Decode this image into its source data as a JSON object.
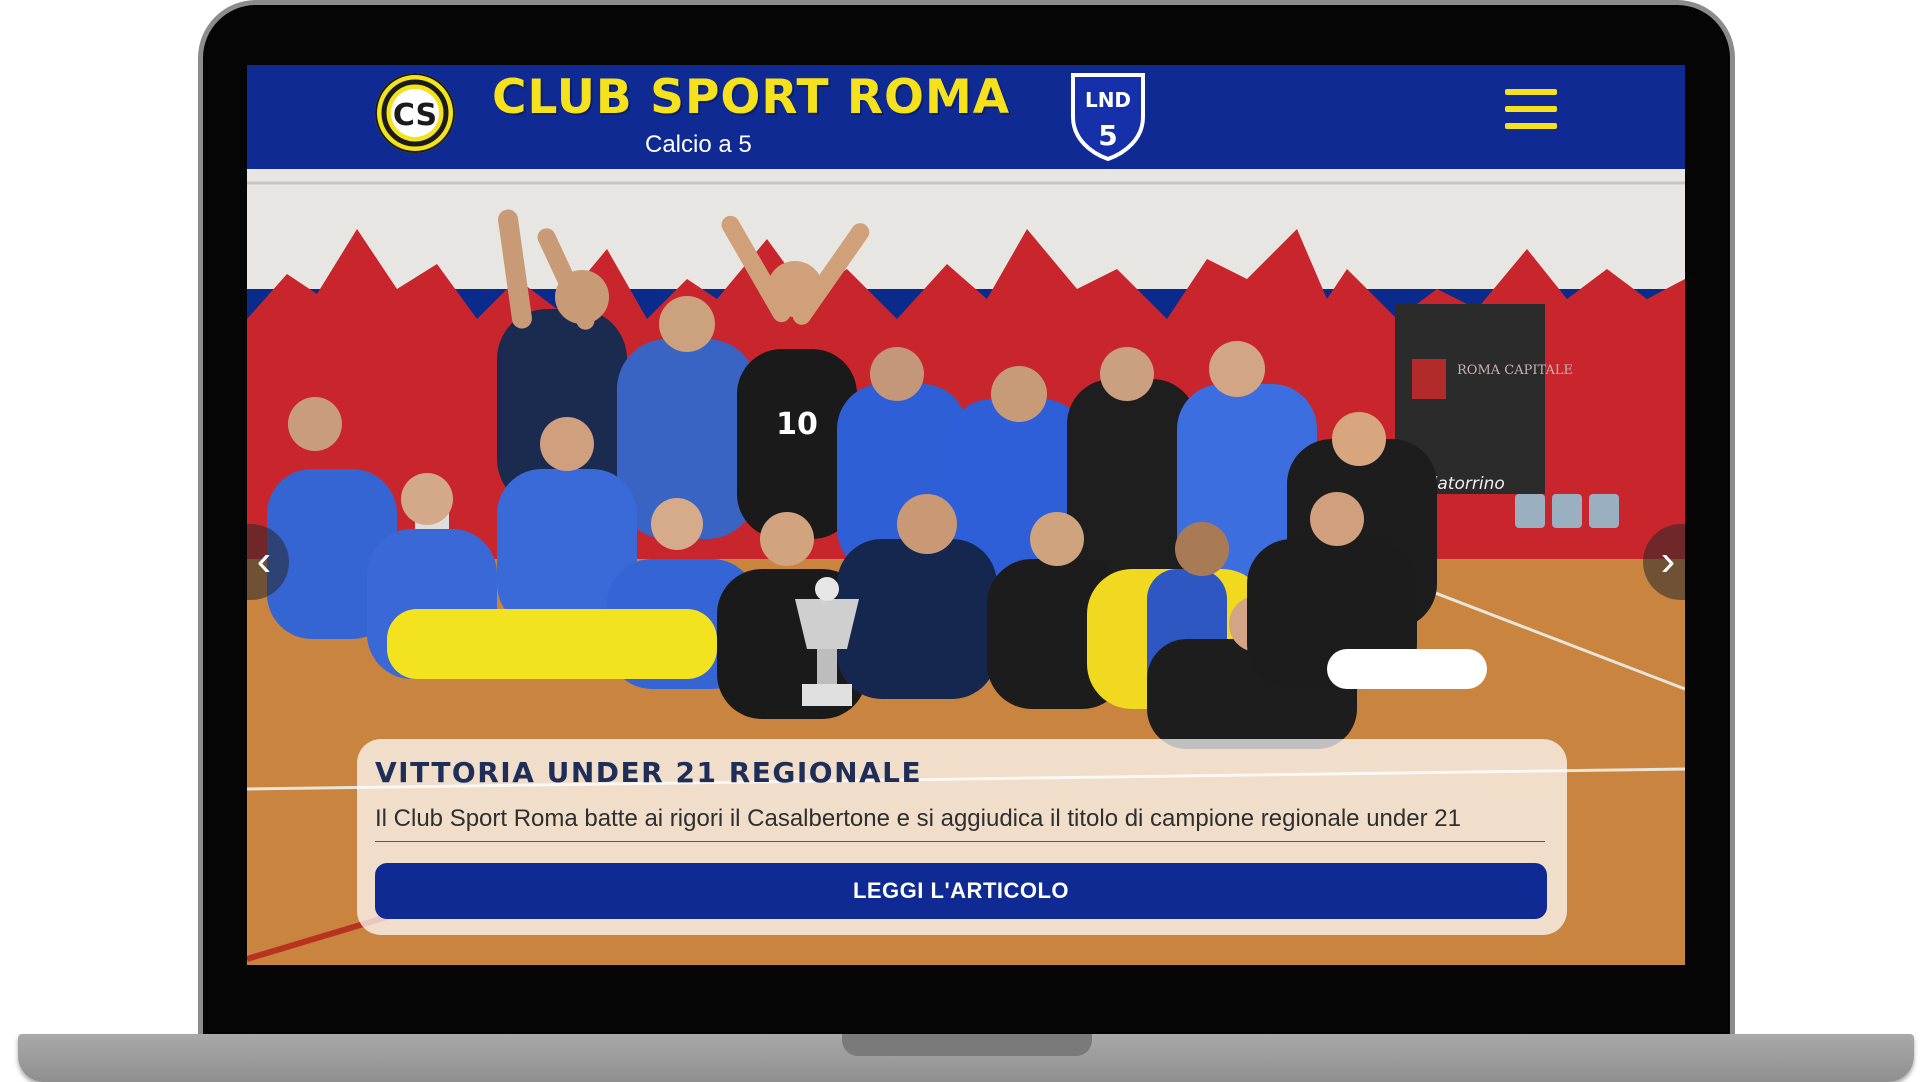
{
  "header": {
    "club_name": "CLUB SPORT ROMA",
    "subtitle": "Calcio a 5",
    "club_logo_initials": "CS",
    "federation_badge_text": "LND",
    "federation_badge_number": "5",
    "menu_icon": "hamburger-menu-icon"
  },
  "hero": {
    "photo_banner_text": "ROMA CAPITALE",
    "photo_venue_text": "Palatorrino",
    "photo_jersey_number": "10",
    "prev_icon": "‹",
    "next_icon": "›",
    "title": "VITTORIA UNDER 21 REGIONALE",
    "description": "Il Club Sport Roma batte ai rigori il Casalbertone e si aggiudica il titolo di campione regionale under 21",
    "button_label": "LEGGI L'ARTICOLO"
  },
  "colors": {
    "brand_blue": "#0f2b93",
    "brand_yellow": "#f5e11c",
    "photo_wall_red": "#c8262c",
    "photo_floor": "#c77d3e"
  }
}
